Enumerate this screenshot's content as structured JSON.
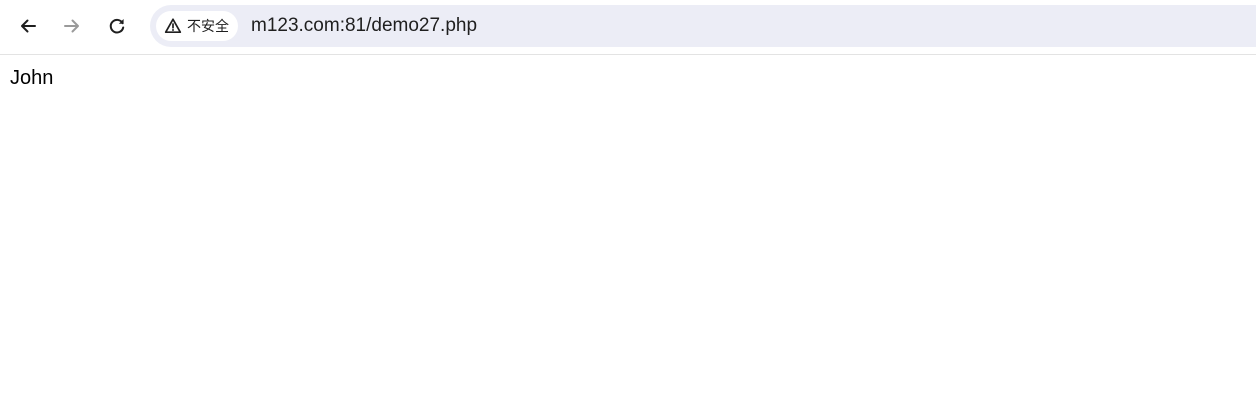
{
  "browser": {
    "nav": {
      "back_icon": "arrow-left-icon",
      "forward_icon": "arrow-right-icon",
      "reload_icon": "reload-icon"
    },
    "address_bar": {
      "security_icon": "warning-triangle-icon",
      "security_label": "不安全",
      "url": "m123.com:81/demo27.php"
    },
    "colors": {
      "omnibox_bg": "#ecedf6",
      "icon_active": "#1f1f1f",
      "icon_disabled": "#9a9a9a"
    }
  },
  "page": {
    "text": "John"
  }
}
